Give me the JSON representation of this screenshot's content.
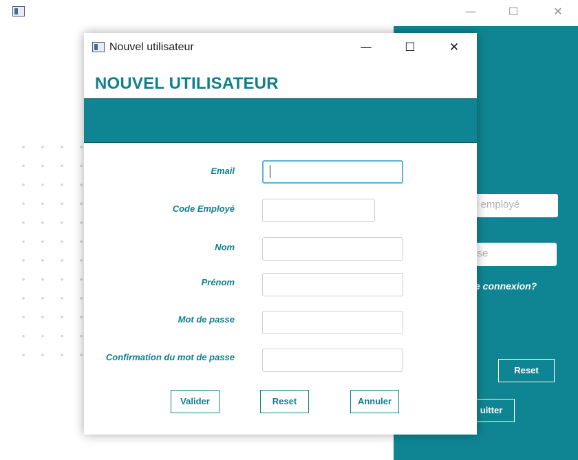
{
  "background_window": {
    "icon": "app-window-icon",
    "controls": {
      "minimize": "—",
      "maximize": "☐",
      "close": "✕"
    },
    "employee_code_placeholder": "e employé",
    "password_placeholder": "sse",
    "forgot_link": "e connexion?",
    "reset_label": "Reset",
    "quit_label": "uitter",
    "accent_color": "#0f8593"
  },
  "dialog": {
    "icon": "app-window-icon",
    "title": "Nouvel utilisateur",
    "controls": {
      "minimize": "—",
      "maximize": "☐",
      "close": "✕"
    },
    "heading": "NOUVEL UTILISATEUR",
    "fields": [
      {
        "label": "Email",
        "value": "",
        "focused": true
      },
      {
        "label": "Code Employé",
        "value": ""
      },
      {
        "label": "Nom",
        "value": ""
      },
      {
        "label": "Prénom",
        "value": ""
      },
      {
        "label": "Mot de passe",
        "value": ""
      },
      {
        "label": "Confirmation du mot de passe",
        "value": ""
      }
    ],
    "buttons": {
      "validate": "Valider",
      "reset": "Reset",
      "cancel": "Annuler"
    },
    "accent_color": "#0f7f8c"
  }
}
